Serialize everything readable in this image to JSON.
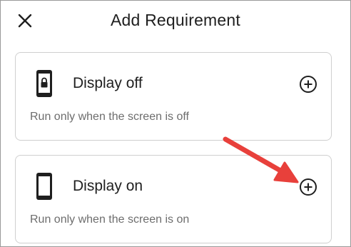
{
  "header": {
    "close_icon": "close-icon",
    "title": "Add Requirement"
  },
  "requirements": [
    {
      "title": "Display off",
      "description": "Run only when the screen is off",
      "icon": "phone-lock-icon",
      "action_icon": "add-circle-icon"
    },
    {
      "title": "Display on",
      "description": "Run only when the screen is on",
      "icon": "phone-icon",
      "action_icon": "add-circle-icon"
    }
  ],
  "annotation": {
    "icon": "red-arrow-pointer",
    "color": "#e8403b"
  },
  "colors": {
    "text": "#202020",
    "secondary_text": "#6d6d6d",
    "card_border": "#cfcfcf"
  }
}
